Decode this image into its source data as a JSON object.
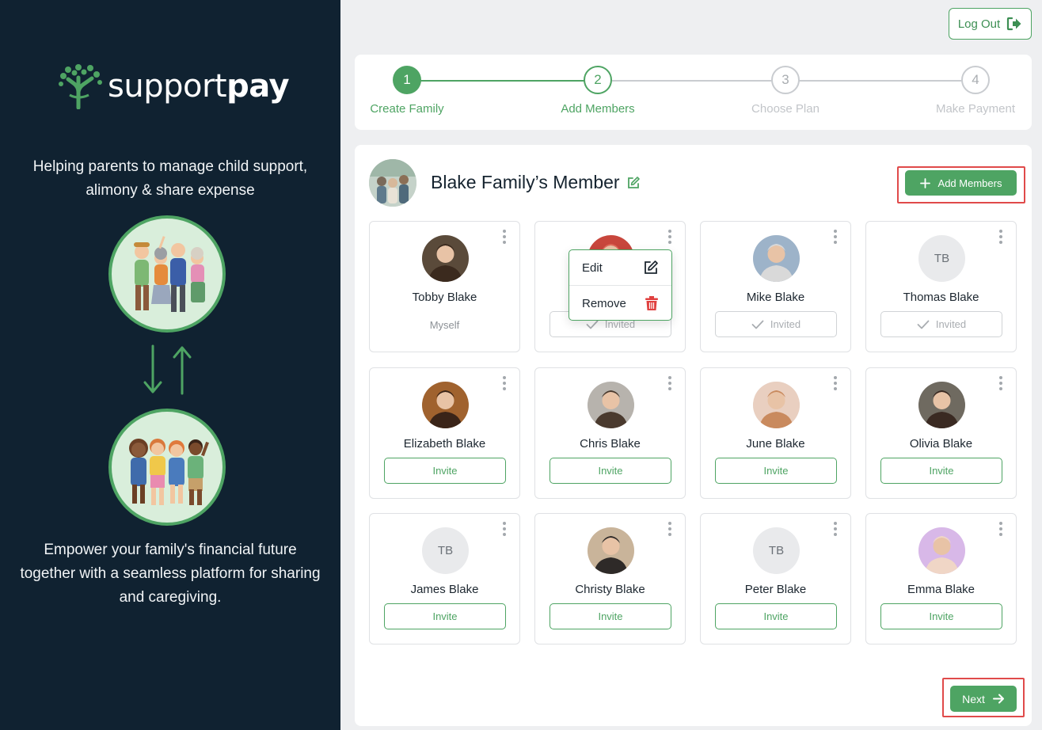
{
  "brand": {
    "name_light": "support",
    "name_bold": "pay",
    "tagline": "Helping parents to manage child support, alimony & share expense",
    "bottom_text": "Empower your family's financial future together with a seamless platform for sharing and caregiving."
  },
  "header": {
    "logout_label": "Log Out"
  },
  "stepper": {
    "steps": [
      {
        "number": "1",
        "label": "Create Family",
        "state": "done"
      },
      {
        "number": "2",
        "label": "Add Members",
        "state": "active"
      },
      {
        "number": "3",
        "label": "Choose Plan",
        "state": "pending"
      },
      {
        "number": "4",
        "label": "Make Payment",
        "state": "pending"
      }
    ]
  },
  "family": {
    "title": "Blake Family’s Member",
    "add_members_label": "Add Members"
  },
  "members": [
    {
      "name": "Tobby Blake",
      "status": "myself",
      "status_label": "Myself",
      "avatar": "photo",
      "initials": ""
    },
    {
      "name": "",
      "status": "invited",
      "status_label": "Invited",
      "avatar": "photo",
      "initials": ""
    },
    {
      "name": "Mike Blake",
      "status": "invited",
      "status_label": "Invited",
      "avatar": "photo",
      "initials": ""
    },
    {
      "name": "Thomas Blake",
      "status": "invited",
      "status_label": "Invited",
      "avatar": "initials",
      "initials": "TB"
    },
    {
      "name": "Elizabeth Blake",
      "status": "invite",
      "status_label": "Invite",
      "avatar": "photo",
      "initials": ""
    },
    {
      "name": "Chris Blake",
      "status": "invite",
      "status_label": "Invite",
      "avatar": "photo",
      "initials": ""
    },
    {
      "name": "June Blake",
      "status": "invite",
      "status_label": "Invite",
      "avatar": "photo",
      "initials": ""
    },
    {
      "name": "Olivia Blake",
      "status": "invite",
      "status_label": "Invite",
      "avatar": "photo",
      "initials": ""
    },
    {
      "name": "James Blake",
      "status": "invite",
      "status_label": "Invite",
      "avatar": "initials",
      "initials": "TB"
    },
    {
      "name": "Christy Blake",
      "status": "invite",
      "status_label": "Invite",
      "avatar": "photo",
      "initials": ""
    },
    {
      "name": "Peter Blake",
      "status": "invite",
      "status_label": "Invite",
      "avatar": "initials",
      "initials": "TB"
    },
    {
      "name": "Emma Blake",
      "status": "invite",
      "status_label": "Invite",
      "avatar": "photo",
      "initials": ""
    }
  ],
  "context_menu": {
    "edit_label": "Edit",
    "remove_label": "Remove"
  },
  "footer": {
    "next_label": "Next"
  },
  "colors": {
    "accent": "#4ea463",
    "sidebar_bg": "#102231",
    "danger": "#e0403f",
    "highlight": "#e04a4a"
  }
}
